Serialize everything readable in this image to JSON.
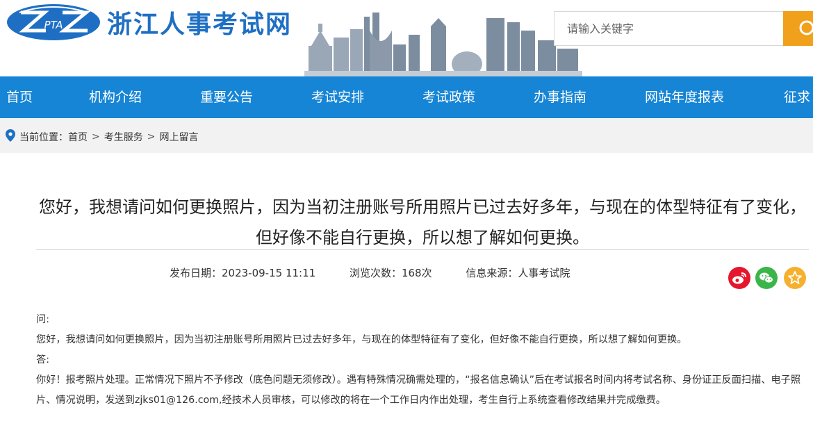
{
  "header": {
    "logo_text": "PTA",
    "site_title": "浙江人事考试网",
    "search_placeholder": "请输入关键字"
  },
  "nav": {
    "items": [
      "首页",
      "机构介绍",
      "重要公告",
      "考试安排",
      "考试政策",
      "办事指南",
      "网站年度报表",
      "征求"
    ]
  },
  "breadcrumb": {
    "label": "当前位置：",
    "items": [
      "首页",
      "考生服务",
      "网上留言"
    ],
    "separator": ">"
  },
  "article": {
    "title": "您好，我想请问如何更换照片，因为当初注册账号所用照片已过去好多年，与现在的体型特征有了变化，但好像不能自行更换，所以想了解如何更换。",
    "publish_date": "发布日期：2023-09-15 11:11",
    "views": "浏览次数：168次",
    "source": "信息来源：人事考试院",
    "question_label": "问:",
    "question_text": "您好，我想请问如何更换照片，因为当初注册账号所用照片已过去好多年，与现在的体型特征有了变化，但好像不能自行更换，所以想了解如何更换。",
    "answer_label": "答:",
    "answer_text": "你好！报考照片处理。正常情况下照片不予修改（底色问题无须修改）。遇有特殊情况确需处理的，“报名信息确认”后在考试报名时间内将考试名称、身份证正反面扫描、电子照片、情况说明，发送到zjks01@126.com,经技术人员审核，可以修改的将在一个工作日内作出处理，考生自行上系统查看修改结果并完成缴费。"
  },
  "share": {
    "weibo_icon": "weibo-icon",
    "wechat_icon": "wechat-icon",
    "favorite_icon": "star-icon",
    "colors": {
      "weibo": "#e6162d",
      "wechat": "#3bb54a",
      "favorite": "#f5b02e"
    }
  },
  "colors": {
    "brand_blue": "#1e6fc4",
    "nav_blue": "#1685d6",
    "search_orange": "#f0a01a"
  }
}
